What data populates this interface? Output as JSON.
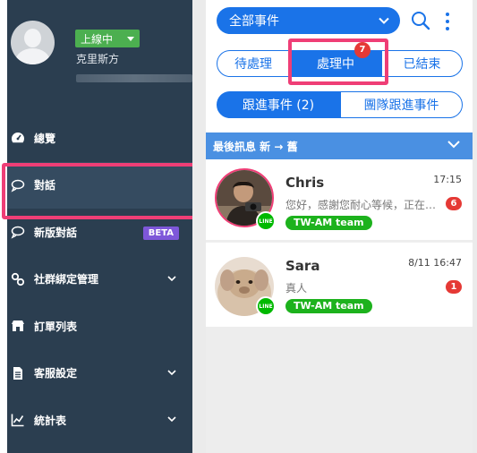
{
  "profile": {
    "status_label": "上線中",
    "user_name": "克里斯方"
  },
  "nav": {
    "items": [
      {
        "label": "總覽",
        "icon": "dashboard-icon"
      },
      {
        "label": "對話",
        "icon": "chat-icon",
        "active": true
      },
      {
        "label": "新版對話",
        "icon": "chat-icon",
        "badge": "BETA"
      },
      {
        "label": "社群綁定管理",
        "icon": "link-icon",
        "expandable": true
      },
      {
        "label": "訂單列表",
        "icon": "store-icon"
      },
      {
        "label": "客服設定",
        "icon": "document-icon",
        "expandable": true
      },
      {
        "label": "統計表",
        "icon": "chart-icon",
        "expandable": true
      }
    ]
  },
  "panel": {
    "event_filter": "全部事件",
    "status_tabs": [
      {
        "label": "待處理"
      },
      {
        "label": "處理中",
        "active": true,
        "badge": "7"
      },
      {
        "label": "已結束"
      }
    ],
    "follow_tabs": [
      {
        "label": "跟進事件 (2)",
        "active": true
      },
      {
        "label": "團隊跟進事件"
      }
    ],
    "list_header": "最後訊息 新 → 舊",
    "conversations": [
      {
        "name": "Chris",
        "time": "17:15",
        "message": "您好，感謝您耐心等候，正在為您處理中",
        "unread": "6",
        "tag": "TW-AM team",
        "channel": "LINE"
      },
      {
        "name": "Sara",
        "time": "8/11 16:47",
        "message": "真人",
        "unread": "1",
        "tag": "TW-AM team",
        "channel": "LINE"
      }
    ]
  },
  "colors": {
    "sidebar": "#2b3e50",
    "primary": "#1a73e8",
    "highlight": "#ef3e76",
    "badge": "#e53935",
    "tag": "#1db21d",
    "list_header": "#4a90e2"
  }
}
